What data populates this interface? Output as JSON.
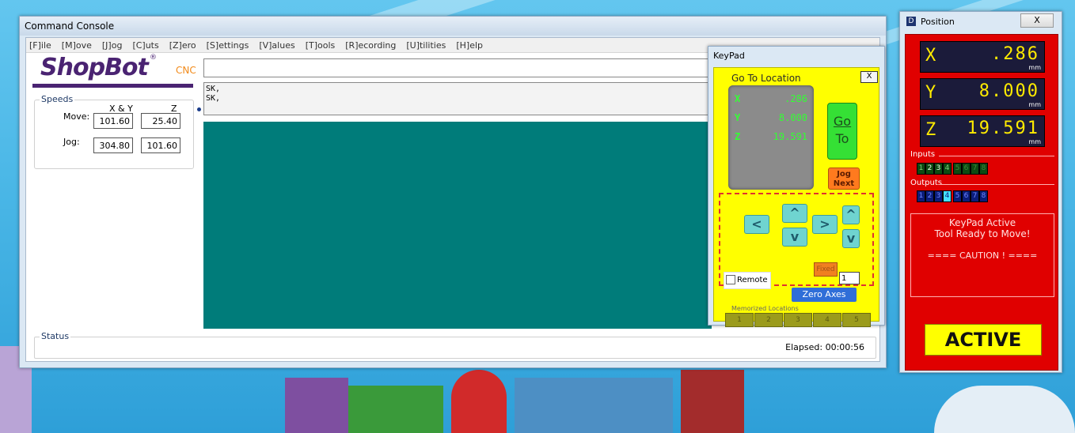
{
  "console": {
    "title": "Command Console",
    "menu": [
      "[F]ile",
      "[M]ove",
      "[J]og",
      "[C]uts",
      "[Z]ero",
      "[S]ettings",
      "[V]alues",
      "[T]ools",
      "[R]ecording",
      "[U]tilities",
      "[H]elp"
    ],
    "logo_text": "ShopBot",
    "logo_suffix": "CNC",
    "logo_mark": "®",
    "speeds": {
      "title": "Speeds",
      "col_xy": "X & Y",
      "col_z": "Z",
      "move_label": "Move:",
      "move_xy": "101.60",
      "move_z": "25.40",
      "jog_label": "Jog:",
      "jog_xy": "304.80",
      "jog_z": "101.60"
    },
    "echo_lines": [
      "SK,",
      "SK,"
    ],
    "status_label": "Status",
    "elapsed": "Elapsed: 00:00:56"
  },
  "keypad": {
    "title": "KeyPad",
    "heading": "Go To Location",
    "close_label": "X",
    "display": [
      {
        "axis": "X",
        "value": ".286"
      },
      {
        "axis": "Y",
        "value": "8.000"
      },
      {
        "axis": "Z",
        "value": "19.591"
      }
    ],
    "goto_line1": "Go",
    "goto_line2": "To",
    "jog_next_line1": "Jog",
    "jog_next_line2": "Next",
    "arrows": {
      "left": "<",
      "right": ">",
      "up": "^",
      "down": "v",
      "z_up": "^",
      "z_down": "v"
    },
    "fixed_label": "Fixed",
    "step_value": "1",
    "remote_label": "Remote",
    "zero_label": "Zero Axes",
    "memorized_label": "Memorized Locations",
    "memory_slots": [
      "1",
      "2",
      "3",
      "4",
      "5"
    ]
  },
  "position": {
    "title": "Position",
    "icon_char": "D",
    "close_label": "X",
    "axes": [
      {
        "letter": "X",
        "value": ".286",
        "unit": "mm"
      },
      {
        "letter": "Y",
        "value": "8.000",
        "unit": "mm"
      },
      {
        "letter": "Z",
        "value": "19.591",
        "unit": "mm"
      }
    ],
    "inputs_label": "Inputs",
    "inputs": [
      "1",
      "2",
      "3",
      "4",
      "5",
      "6",
      "7",
      "8"
    ],
    "outputs_label": "Outputs",
    "outputs": [
      "1",
      "2",
      "3",
      "4",
      "5",
      "6",
      "7",
      "8"
    ],
    "message_line1": "KeyPad Active",
    "message_line2": "Tool Ready to Move!",
    "message_line3": "==== CAUTION ! ====",
    "active_label": "ACTIVE",
    "colors": {
      "panel": "#e00000",
      "display_bg": "#1b1b3a",
      "digits": "#ffeb00",
      "active_bg": "#ffff00"
    }
  }
}
